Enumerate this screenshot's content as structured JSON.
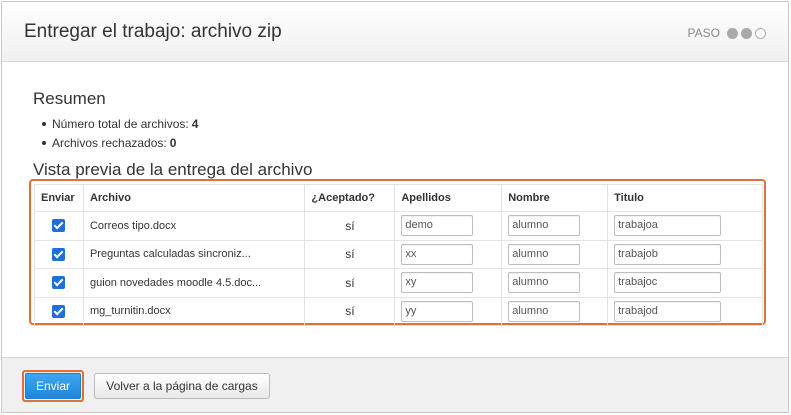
{
  "header": {
    "title": "Entregar el trabajo: archivo zip",
    "step_label": "PASO",
    "steps_total": 3,
    "steps_done": 2
  },
  "summary": {
    "title": "Resumen",
    "items": [
      {
        "label": "Número total de archivos:",
        "value": "4"
      },
      {
        "label": "Archivos rechazados:",
        "value": "0"
      }
    ]
  },
  "preview": {
    "title": "Vista previa de la entrega del archivo",
    "columns": [
      "Enviar",
      "Archivo",
      "¿Aceptado?",
      "Apellidos",
      "Nombre",
      "Titulo"
    ],
    "rows": [
      {
        "send": true,
        "file": "Correos tipo.docx",
        "accepted": "sí",
        "apellidos": "demo",
        "nombre": "alumno",
        "titulo": "trabajoa"
      },
      {
        "send": true,
        "file": "Preguntas calculadas sincroniz...",
        "accepted": "sí",
        "apellidos": "xx",
        "nombre": "alumno",
        "titulo": "trabajob"
      },
      {
        "send": true,
        "file": "guion novedades moodle 4.5.doc...",
        "accepted": "sí",
        "apellidos": "xy",
        "nombre": "alumno",
        "titulo": "trabajoc"
      },
      {
        "send": true,
        "file": "mg_turnitin.docx",
        "accepted": "sí",
        "apellidos": "yy",
        "nombre": "alumno",
        "titulo": "trabajod"
      }
    ]
  },
  "footer": {
    "submit_label": "Enviar",
    "back_label": "Volver a la página de cargas"
  },
  "colors": {
    "highlight": "#e0703a",
    "primary": "#1f86dc",
    "checkbox": "#1e6fd9"
  }
}
